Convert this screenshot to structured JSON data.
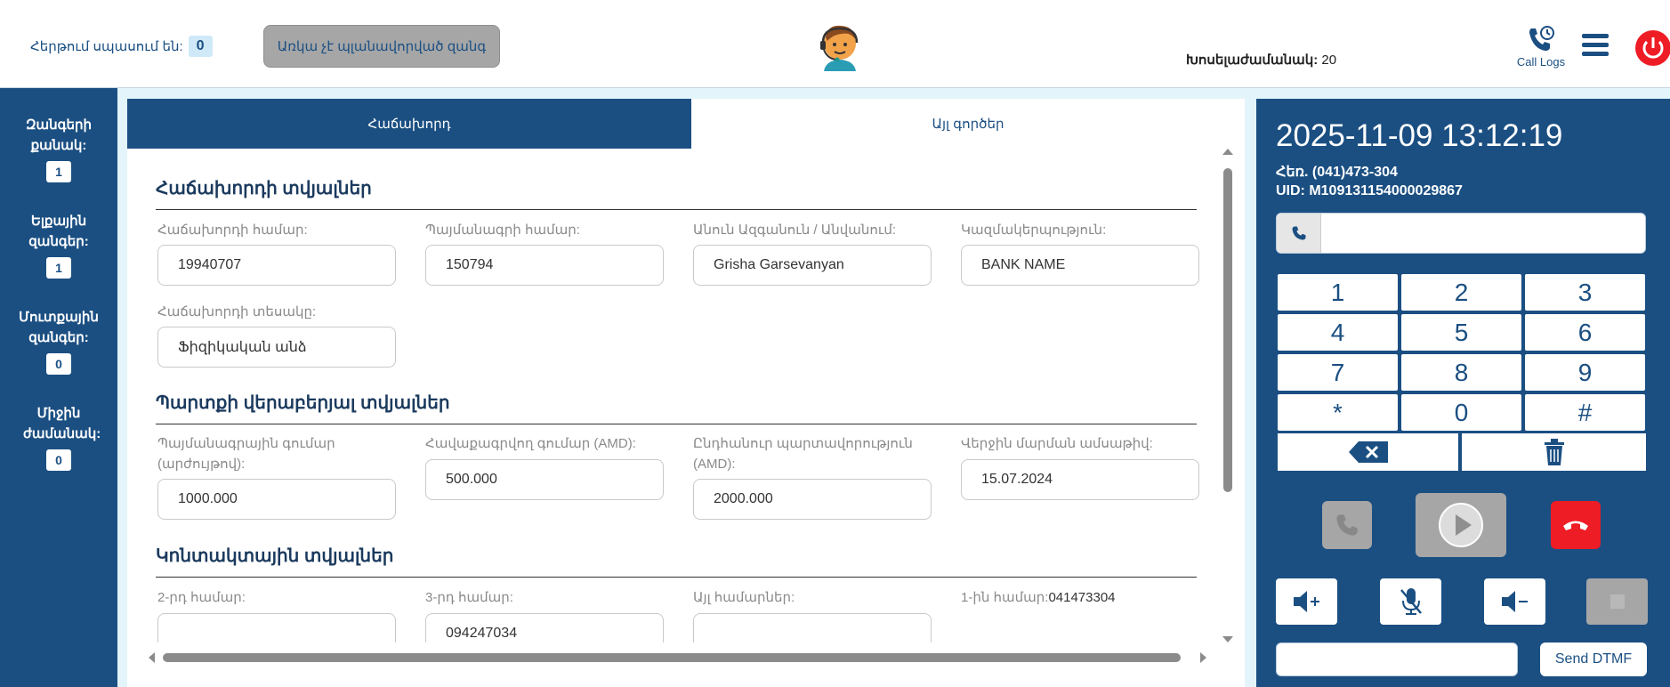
{
  "header": {
    "queue_label": "Հերթում սպասում են:",
    "queue_count": "0",
    "planned_call": "Առկա չէ պլանավորված զանգ",
    "talk_time_label": "Խոսելաժամանակ:",
    "talk_time_value": "20",
    "call_logs": "Call Logs"
  },
  "stats": [
    {
      "label": "Զանգերի քանակ:",
      "value": "1"
    },
    {
      "label": "Ելքային զանգեր:",
      "value": "1"
    },
    {
      "label": "Մուտքային զանգեր:",
      "value": "0"
    },
    {
      "label": "Միջին ժամանակ:",
      "value": "0"
    }
  ],
  "tabs": {
    "client": "Հաճախորդ",
    "other": "Այլ գործեր"
  },
  "sections": {
    "client_data": "Հաճախորդի տվյալներ",
    "debt_data": "Պարտքի վերաբերյալ տվյալներ",
    "contact_data": "Կոնտակտային տվյալներ"
  },
  "client": {
    "client_number_label": "Հաճախորդի համար:",
    "client_number": "19940707",
    "contract_number_label": "Պայմանագրի համար:",
    "contract_number": "150794",
    "name_label": "Անուն Ազգանուն / Անվանում:",
    "name": "Grisha Garsevanyan",
    "organization_label": "Կազմակերպություն:",
    "organization": "BANK NAME",
    "client_type_label": "Հաճախորդի տեսակը:",
    "client_type": "Ֆիզիկական անձ"
  },
  "debt": {
    "contract_amount_label": "Պայմանագրային գումար (արժույթով):",
    "contract_amount": "1000.000",
    "collected_amount_label": "Հավաքագրվող գումար (AMD):",
    "collected_amount": "500.000",
    "total_debt_label": "Ընդհանուր պարտավորություն (AMD):",
    "total_debt": "2000.000",
    "last_payment_label": "Վերջին մարման ամսաթիվ:",
    "last_payment": "15.07.2024"
  },
  "contact": {
    "second_number_label": "2-րդ համար:",
    "second_number": "",
    "third_number_label": "3-րդ համար:",
    "third_number": "094247034",
    "other_numbers_label": "Այլ համարներ:",
    "other_numbers": "",
    "first_number_label": "1-ին համար:",
    "first_number": "041473304"
  },
  "dialer": {
    "datetime": "2025-11-09 13:12:19",
    "phone": "Հեռ. (041)473-304",
    "uid": "UID: M109131154000029867",
    "keys": [
      "1",
      "2",
      "3",
      "4",
      "5",
      "6",
      "7",
      "8",
      "9",
      "*",
      "0",
      "#"
    ],
    "send_dtmf": "Send DTMF"
  },
  "colors": {
    "primary": "#1b4f82",
    "hangup": "#ee1c25",
    "disabled": "#a6a6a6"
  }
}
